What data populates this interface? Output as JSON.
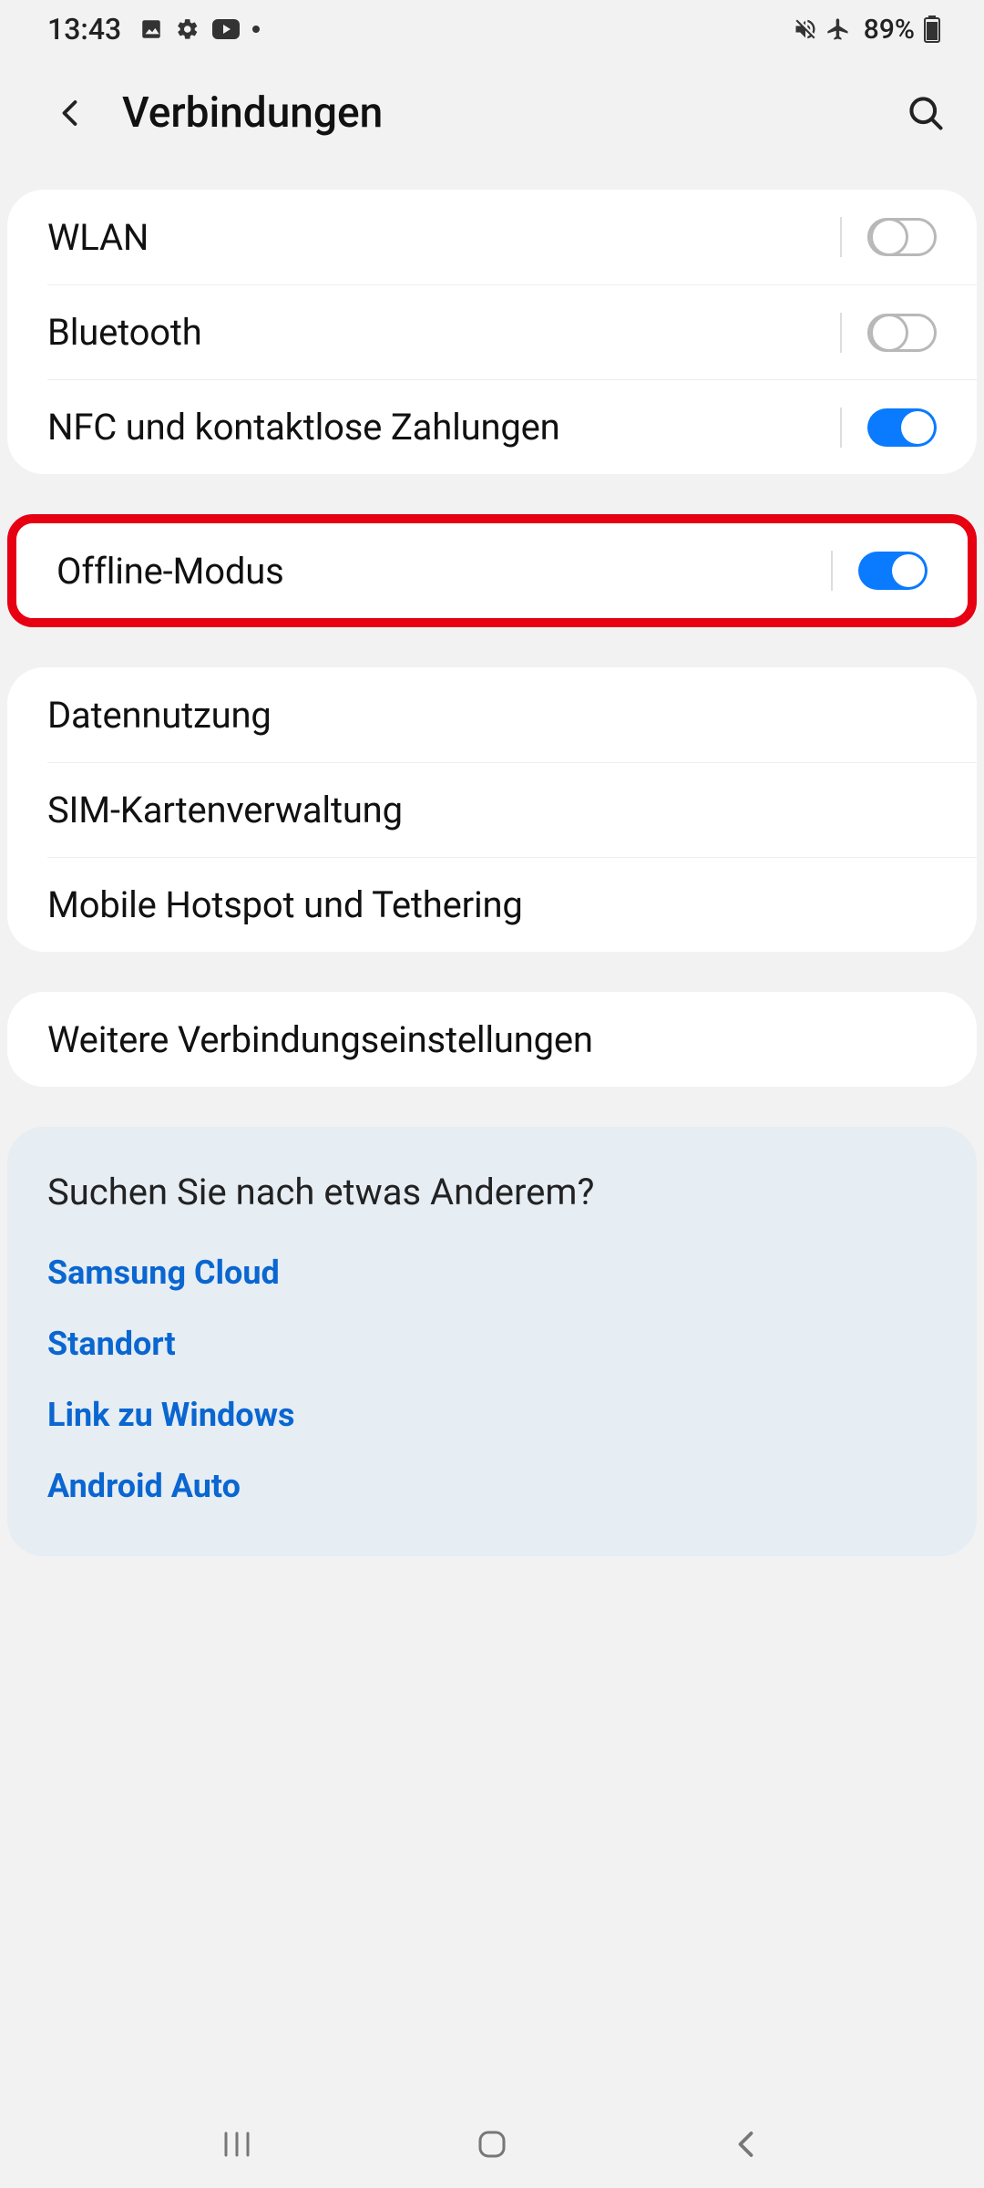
{
  "status": {
    "time": "13:43",
    "battery_pct": "89%"
  },
  "header": {
    "title": "Verbindungen"
  },
  "rows": {
    "wlan": "WLAN",
    "bluetooth": "Bluetooth",
    "nfc": "NFC und kontaktlose Zahlungen",
    "offline": "Offline-Modus",
    "data_usage": "Datennutzung",
    "sim": "SIM-Kartenverwaltung",
    "hotspot": "Mobile Hotspot und Tethering",
    "more": "Weitere Verbindungseinstellungen"
  },
  "toggles": {
    "wlan": false,
    "bluetooth": false,
    "nfc": true,
    "offline": true
  },
  "footer": {
    "title": "Suchen Sie nach etwas Anderem?",
    "links": {
      "samsung_cloud": "Samsung Cloud",
      "standort": "Standort",
      "link_windows": "Link zu Windows",
      "android_auto": "Android Auto"
    }
  }
}
